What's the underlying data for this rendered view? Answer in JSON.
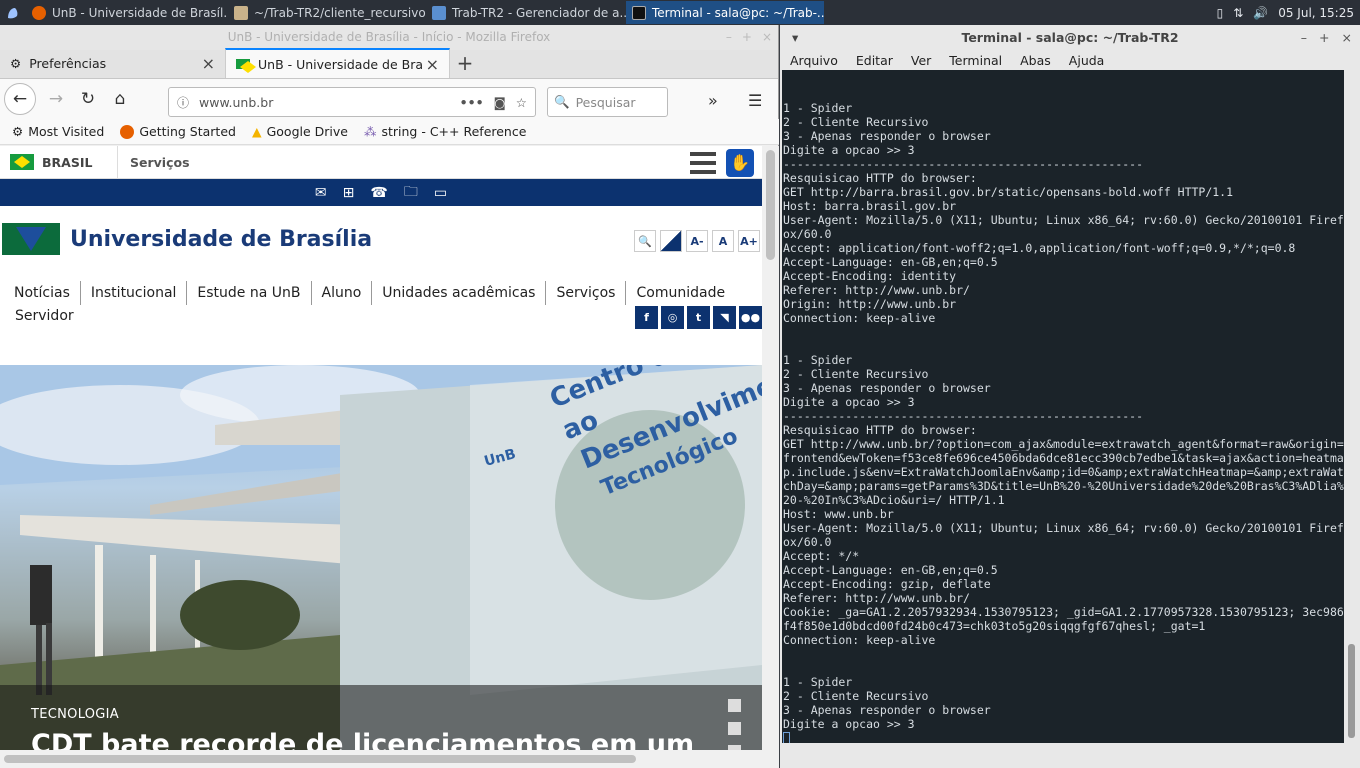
{
  "taskbar": {
    "tasks": [
      {
        "label": "UnB - Universidade de Brasíl..."
      },
      {
        "label": "~/Trab-TR2/cliente_recursivo..."
      },
      {
        "label": "Trab-TR2 - Gerenciador de a..."
      },
      {
        "label": "Terminal - sala@pc: ~/Trab-..."
      }
    ],
    "clock": "05 Jul, 15:25"
  },
  "firefox": {
    "window_title": "UnB - Universidade de Brasília - Início - Mozilla Firefox",
    "tabs": [
      {
        "label": "Preferências"
      },
      {
        "label": "UnB - Universidade de Brasíli"
      }
    ],
    "url": "www.unb.br",
    "search_placeholder": "Pesquisar",
    "bookmarks": [
      {
        "label": "Most Visited"
      },
      {
        "label": "Getting Started"
      },
      {
        "label": "Google Drive"
      },
      {
        "label": "string - C++ Reference"
      }
    ]
  },
  "site": {
    "gov": {
      "brasil": "BRASIL",
      "servicos": "Serviços"
    },
    "name": "Universidade de Brasília",
    "accessibility": {
      "contrast": "",
      "a_minus": "A-",
      "a": "A",
      "a_plus": "A+"
    },
    "menu": [
      "Notícias",
      "Institucional",
      "Estude na UnB",
      "Aluno",
      "Unidades acadêmicas",
      "Serviços",
      "Comunidade"
    ],
    "menu_servidor": "Servidor",
    "hero": {
      "tag": "TECNOLOGIA",
      "title": "CDT bate recorde de licenciamentos em um",
      "sign_lines": [
        "Centro de Apoio ao",
        "Desenvolvimento",
        "Tecnológico"
      ],
      "sign_unb": "UnB"
    }
  },
  "terminal": {
    "window_title": "Terminal - sala@pc: ~/Trab-TR2",
    "menu": [
      "Arquivo",
      "Editar",
      "Ver",
      "Terminal",
      "Abas",
      "Ajuda"
    ],
    "output": "\n\n1 - Spider\n2 - Cliente Recursivo\n3 - Apenas responder o browser\nDigite a opcao >> 3\n----------------------------------------------------\nResquisicao HTTP do browser:\nGET http://barra.brasil.gov.br/static/opensans-bold.woff HTTP/1.1\nHost: barra.brasil.gov.br\nUser-Agent: Mozilla/5.0 (X11; Ubuntu; Linux x86_64; rv:60.0) Gecko/20100101 Firefox/60.0\nAccept: application/font-woff2;q=1.0,application/font-woff;q=0.9,*/*;q=0.8\nAccept-Language: en-GB,en;q=0.5\nAccept-Encoding: identity\nReferer: http://www.unb.br/\nOrigin: http://www.unb.br\nConnection: keep-alive\n\n\n1 - Spider\n2 - Cliente Recursivo\n3 - Apenas responder o browser\nDigite a opcao >> 3\n----------------------------------------------------\nResquisicao HTTP do browser:\nGET http://www.unb.br/?option=com_ajax&module=extrawatch_agent&format=raw&origin=frontend&ewToken=f53ce8fe696ce4506bda6dce81ecc390cb7edbe1&task=ajax&action=heatmap.include.js&env=ExtraWatchJoomlaEnv&amp;id=0&amp;extraWatchHeatmap=&amp;extraWatchDay=&amp;params=getParams%3D&title=UnB%20-%20Universidade%20de%20Bras%C3%ADlia%20-%20In%C3%ADcio&uri=/ HTTP/1.1\nHost: www.unb.br\nUser-Agent: Mozilla/5.0 (X11; Ubuntu; Linux x86_64; rv:60.0) Gecko/20100101 Firefox/60.0\nAccept: */*\nAccept-Language: en-GB,en;q=0.5\nAccept-Encoding: gzip, deflate\nReferer: http://www.unb.br/\nCookie: _ga=GA1.2.2057932934.1530795123; _gid=GA1.2.1770957328.1530795123; 3ec986f4f850e1d0bdcd00fd24b0c473=chk03to5g20siqqgfgf67qhesl; _gat=1\nConnection: keep-alive\n\n\n1 - Spider\n2 - Cliente Recursivo\n3 - Apenas responder o browser\nDigite a opcao >> 3\n"
  },
  "colors": {
    "gov_blue": "#0c326f",
    "unb_green": "#0c6b3c",
    "terminal_bg": "#1b2329",
    "taskbar_active": "#1f4f85"
  }
}
